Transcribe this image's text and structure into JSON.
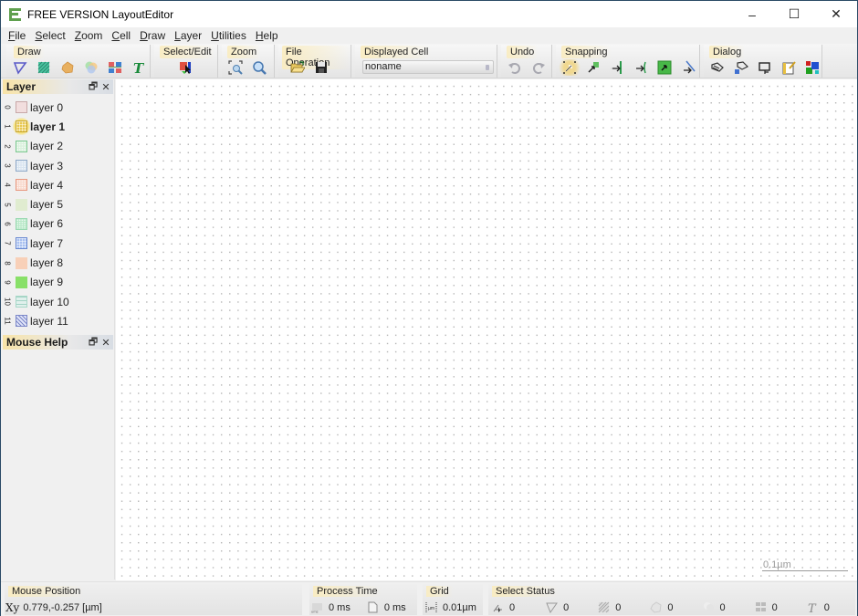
{
  "window": {
    "title": "FREE VERSION LayoutEditor",
    "controls": {
      "minimize": "–",
      "maximize": "☐",
      "close": "✕"
    }
  },
  "menu": [
    {
      "label": "File",
      "accel": "F",
      "rest": "ile"
    },
    {
      "label": "Select",
      "accel": "S",
      "rest": "elect"
    },
    {
      "label": "Zoom",
      "accel": "Z",
      "rest": "oom"
    },
    {
      "label": "Cell",
      "accel": "C",
      "rest": "ell"
    },
    {
      "label": "Draw",
      "accel": "D",
      "rest": "raw"
    },
    {
      "label": "Layer",
      "accel": "L",
      "rest": "ayer"
    },
    {
      "label": "Utilities",
      "accel": "U",
      "rest": "tilities"
    },
    {
      "label": "Help",
      "accel": "H",
      "rest": "elp"
    }
  ],
  "toolbar": {
    "groups": {
      "draw": {
        "label": "Draw",
        "icons": [
          "polygon-icon",
          "box-icon",
          "path-icon",
          "circle-icon",
          "cell-ref-icon",
          "text-icon"
        ]
      },
      "select_edit": {
        "label": "Select/Edit",
        "icons": [
          "select-edit-icon"
        ]
      },
      "zoom": {
        "label": "Zoom",
        "icons": [
          "zoom-fit-icon",
          "zoom-magnifier-icon"
        ]
      },
      "file_operation": {
        "label": "File Operation",
        "icons": [
          "open-folder-icon",
          "save-icon"
        ]
      },
      "displayed_cell": {
        "label": "Displayed Cell",
        "value": "noname"
      },
      "undo": {
        "label": "Undo",
        "icons": [
          "undo-icon",
          "redo-icon"
        ]
      },
      "snapping": {
        "label": "Snapping",
        "icons": [
          "snap-grid-icon",
          "snap-point-icon",
          "snap-edge-icon",
          "snap-edge-open-icon",
          "snap-area-icon",
          "snap-diagonal-icon"
        ]
      },
      "dialog": {
        "label": "Dialog",
        "icons": [
          "properties-dialog-icon",
          "layer-dialog-icon",
          "cell-dialog-icon",
          "notes-dialog-icon",
          "color-dialog-icon"
        ]
      }
    }
  },
  "layer_panel": {
    "title": "Layer",
    "float_icon": "🗗",
    "close_icon": "✕",
    "layers": [
      {
        "num": "0",
        "name": "layer 0",
        "color": "#f2dede",
        "border": "#c8a8a8",
        "pattern": "none",
        "active": false
      },
      {
        "num": "1",
        "name": "layer 1",
        "color": "#e8c850",
        "border": "#c8a838",
        "pattern": "grid",
        "active": true
      },
      {
        "num": "2",
        "name": "layer 2",
        "color": "#d8f0dc",
        "border": "#7cc890",
        "pattern": "dots",
        "active": false
      },
      {
        "num": "3",
        "name": "layer 3",
        "color": "#d8e4f0",
        "border": "#90aac8",
        "pattern": "dots",
        "active": false
      },
      {
        "num": "4",
        "name": "layer 4",
        "color": "#f8d8cc",
        "border": "#e89880",
        "pattern": "dots",
        "active": false
      },
      {
        "num": "5",
        "name": "layer 5",
        "color": "#e0ecd0",
        "border": "#e0ecd0",
        "pattern": "none",
        "active": false
      },
      {
        "num": "6",
        "name": "layer 6",
        "color": "#b8e8c8",
        "border": "#98d8b0",
        "pattern": "dots",
        "active": false
      },
      {
        "num": "7",
        "name": "layer 7",
        "color": "#a8c0f0",
        "border": "#6888d0",
        "pattern": "grid",
        "active": false
      },
      {
        "num": "8",
        "name": "layer 8",
        "color": "#f8d0b8",
        "border": "#f8d0b8",
        "pattern": "none",
        "active": false
      },
      {
        "num": "9",
        "name": "layer 9",
        "color": "#88e068",
        "border": "#88e068",
        "pattern": "none",
        "active": false
      },
      {
        "num": "10",
        "name": "layer 10",
        "color": "#e0f0ec",
        "border": "#a8d8c8",
        "pattern": "lines",
        "active": false
      },
      {
        "num": "11",
        "name": "layer 11",
        "color": "#e0e4f8",
        "border": "#7c88c8",
        "pattern": "hatch",
        "active": false
      }
    ]
  },
  "mouse_help_panel": {
    "title": "Mouse Help",
    "float_icon": "🗗",
    "close_icon": "✕"
  },
  "canvas": {
    "scale_label": "0.1µm"
  },
  "statusbar": {
    "mouse_position": {
      "label": "Mouse Position",
      "icon": "Xy",
      "value": "0.779,-0.257 [µm]"
    },
    "process_time": {
      "label": "Process Time",
      "render_time": "0 ms",
      "file_time": "0 ms"
    },
    "grid": {
      "label": "Grid",
      "value": "0.01µm"
    },
    "select_status": {
      "label": "Select Status",
      "counts": [
        {
          "icon": "select-point-icon",
          "value": "0"
        },
        {
          "icon": "polygon-icon",
          "value": "0"
        },
        {
          "icon": "box-icon",
          "value": "0"
        },
        {
          "icon": "path-icon",
          "value": "0"
        },
        {
          "icon": "circle-icon",
          "value": "0"
        },
        {
          "icon": "cell-ref-icon",
          "value": "0"
        },
        {
          "icon": "text-icon",
          "value": "0"
        }
      ]
    }
  }
}
